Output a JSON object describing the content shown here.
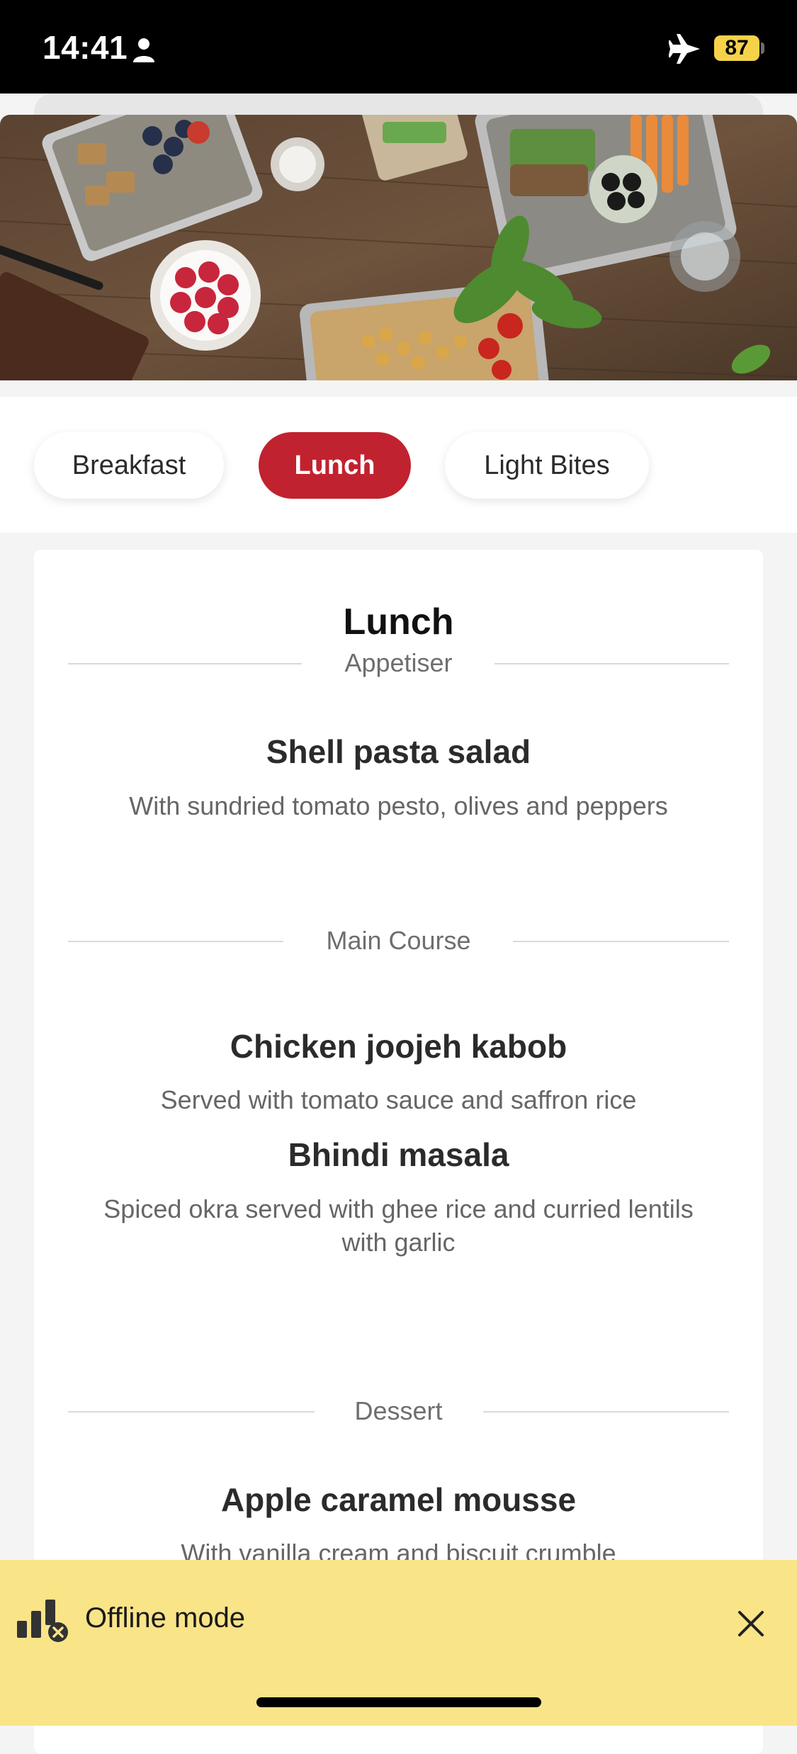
{
  "status_bar": {
    "time": "14:41",
    "battery": "87",
    "icons": [
      "person-icon",
      "airplane-icon",
      "battery-icon"
    ]
  },
  "tabs": [
    {
      "label": "Breakfast",
      "active": false
    },
    {
      "label": "Lunch",
      "active": true
    },
    {
      "label": "Light Bites",
      "active": false
    }
  ],
  "menu": {
    "title": "Lunch",
    "sections": {
      "appetiser": {
        "label": "Appetiser",
        "items": [
          {
            "name": "Shell pasta salad",
            "description": "With sundried tomato pesto, olives and peppers"
          }
        ]
      },
      "main_course": {
        "label": "Main Course",
        "items": [
          {
            "name": "Chicken joojeh kabob",
            "description": "Served with tomato sauce and saffron rice"
          },
          {
            "name": "Bhindi masala",
            "description": "Spiced okra served with ghee rice and curried lentils with garlic"
          }
        ]
      },
      "dessert": {
        "label": "Dessert",
        "items": [
          {
            "name": "Apple caramel mousse",
            "description": "With vanilla cream and biscuit crumble"
          }
        ]
      }
    }
  },
  "offline_banner": {
    "text": "Offline mode",
    "icon": "signal-offline-icon"
  },
  "colors": {
    "accent": "#c1222f",
    "banner": "#f9e488",
    "battery": "#f5d24a"
  }
}
